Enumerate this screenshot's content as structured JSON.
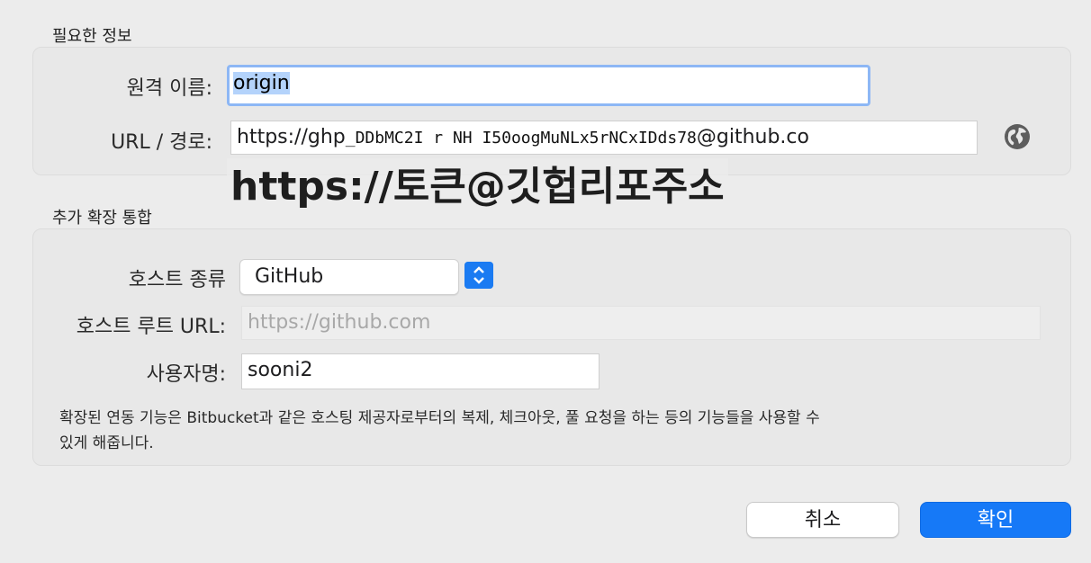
{
  "required_section": {
    "title": "필요한 정보",
    "remote_name_label": "원격 이름:",
    "remote_name_value": "origin",
    "url_label": "URL / 경로:",
    "url_value_prefix": "https://ghp",
    "url_value_obscured": "_DDbMC2I r NH I50oogMuNLx5rNCxIDds78",
    "url_value_suffix": "@github.co",
    "globe_icon": "globe-icon"
  },
  "overlay_annotation": "https://토큰@깃헙리포주소",
  "extension_section": {
    "title": "추가 확장 통합",
    "host_type_label": "호스트 종류",
    "host_type_value": "GitHub",
    "host_root_url_label": "호스트 루트 URL:",
    "host_root_url_placeholder": "https://github.com",
    "username_label": "사용자명:",
    "username_value": "sooni2",
    "hint_line1": "확장된 연동 기능은 Bitbucket과 같은 호스팅 제공자로부터의 복제, 체크아웃, 풀 요청을 하는 등의 기능들을 사용할 수",
    "hint_line2": "있게 해줍니다."
  },
  "buttons": {
    "cancel_label": "취소",
    "ok_label": "확인"
  },
  "colors": {
    "accent": "#1679f7",
    "focus_ring": "#8db7f5",
    "selection": "#b4d3fb"
  }
}
